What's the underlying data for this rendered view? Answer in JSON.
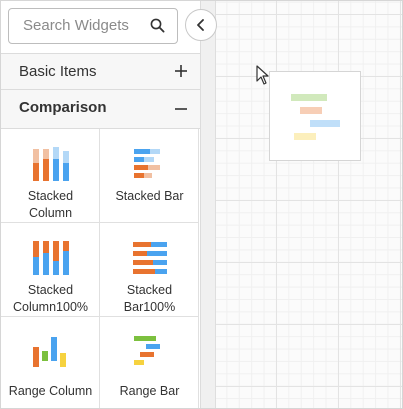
{
  "search": {
    "placeholder": "Search Widgets",
    "icon": "search-icon"
  },
  "collapse_button": {
    "icon": "chevron-left-icon"
  },
  "sections": [
    {
      "label": "Basic Items",
      "expanded": false,
      "toggle": "+"
    },
    {
      "label": "Comparison",
      "expanded": true,
      "toggle": "–"
    }
  ],
  "widgets": [
    {
      "label_lines": [
        "Stacked",
        "Column"
      ],
      "icon": "stacked-column-icon"
    },
    {
      "label_lines": [
        "Stacked Bar"
      ],
      "icon": "stacked-bar-icon"
    },
    {
      "label_lines": [
        "Stacked",
        "Column100%"
      ],
      "icon": "stacked-column100-icon"
    },
    {
      "label_lines": [
        "Stacked",
        "Bar100%"
      ],
      "icon": "stacked-bar100-icon"
    },
    {
      "label_lines": [
        "Range Column"
      ],
      "icon": "range-column-icon"
    },
    {
      "label_lines": [
        "Range Bar"
      ],
      "icon": "range-bar-icon"
    }
  ],
  "colors": {
    "orange": "#e8732f",
    "blue": "#4aa3ef",
    "light_orange": "#f1c0a2",
    "light_blue": "#b3d8f7",
    "green": "#7cc03e",
    "yellow": "#f6d23f"
  }
}
